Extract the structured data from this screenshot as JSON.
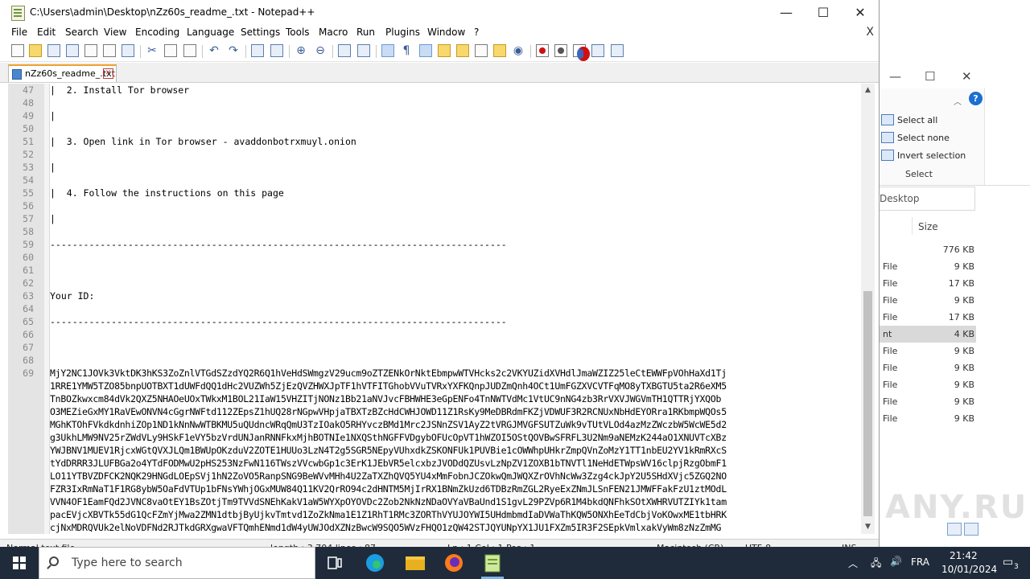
{
  "window": {
    "title": "C:\\Users\\admin\\Desktop\\nZz60s_readme_.txt - Notepad++"
  },
  "menu": [
    "File",
    "Edit",
    "Search",
    "View",
    "Encoding",
    "Language",
    "Settings",
    "Tools",
    "Macro",
    "Run",
    "Plugins",
    "Window",
    "?"
  ],
  "menu_close": "X",
  "tab": {
    "label": "nZz60s_readme_.txt"
  },
  "editor": {
    "lines": [
      {
        "n": "47",
        "text": "|  2. Install Tor browser"
      },
      {
        "n": "48",
        "text": ""
      },
      {
        "n": "49",
        "text": "|"
      },
      {
        "n": "50",
        "text": ""
      },
      {
        "n": "51",
        "text": "|  3. Open link in Tor browser - avaddonbotrxmuyl.onion"
      },
      {
        "n": "52",
        "text": ""
      },
      {
        "n": "53",
        "text": "|"
      },
      {
        "n": "54",
        "text": ""
      },
      {
        "n": "55",
        "text": "|  4. Follow the instructions on this page"
      },
      {
        "n": "56",
        "text": ""
      },
      {
        "n": "57",
        "text": "|"
      },
      {
        "n": "58",
        "text": ""
      },
      {
        "n": "59",
        "text": "----------------------------------------------------------------------------------"
      },
      {
        "n": "60",
        "text": ""
      },
      {
        "n": "61",
        "text": ""
      },
      {
        "n": "62",
        "text": ""
      },
      {
        "n": "63",
        "text": "Your ID:"
      },
      {
        "n": "64",
        "text": ""
      },
      {
        "n": "65",
        "text": "----------------------------------------------------------------------------------"
      },
      {
        "n": "66",
        "text": ""
      },
      {
        "n": "67",
        "text": ""
      },
      {
        "n": "68",
        "text": ""
      },
      {
        "n": "69",
        "text": ""
      }
    ],
    "id_block": [
      "MjY2NC1JOVk3VktDK3hKS3ZoZnlVTGdSZzdYQ2R6Q1hVeHdSWmgzV29ucm9oZTZENkOrNktEbmpwWTVHcks2c2VKYUZidXVHdlJmaWZIZ25leCtEWWFpVOhHaXd1Tj",
      "1RRE1YMW5TZO85bnpUOTBXT1dUWFdQQ1dHc2VUZWh5ZjEzQVZHWXJpTF1hVTFITGhobVVuTVRxYXFKQnpJUDZmQnh4OCt1UmFGZXVCVTFqMO8yTXBGTU5ta2R6eXM5",
      "TnBOZkwxcm84dVk2QXZ5NHAOeUOxTWkxM1BOL21IaW15VHZITjNONz1Bb21aNVJvcFBHWHE3eGpENFo4TnNWTVdMc1VtUC9nNG4zb3RrVXVJWGVmTH1QTTRjYXQOb",
      "O3MEZieGxMY1RaVEwONVN4cGgrNWFtd112ZEpsZ1hUQ28rNGpwVHpjaTBXTzBZcHdCWHJOWD11Z1RsKy9MeDBRdmFKZjVDWUF3R2RCNUxNbHdEYORra1RKbmpWQOs5",
      "MGhKTOhFVkdkdnhiZOp1ND1kNnNwWTBKMU5uQUdncWRqQmU3TzIOakO5RHYvczBMd1Mrc2JSNnZSV1AyZ2tVRGJMVGFSUTZuWk9vTUtVLOd4azMzZWczbW5WcWE5d2",
      "g3UkhLMW9NV25rZWdVLy9HSkF1eVY5bzVrdUNJanRNNFkxMjhBOTNIe1NXQSthNGFFVDgybOFUcOpVT1hWZOI5OStQOVBwSFRFL3U2Nm9aNEMzK244aO1XNUVTcXBz",
      "YWJBNV1MUEV1RjcxWGtQVXJLQm1BWUpOKzduV2ZOTE1HUUo3LzN4T2g5SGR5NEpyVUhxdkZSKONFUk1PUVBie1cOWWhpUHkrZmpQVnZoMzY1TT1nbEU2YV1kRmRXcS",
      "tYdDRRR3JLUFBGa2o4YTdFODMwU2pHS253NzFwN116TWszVVcwbGp1c3ErK1JEbVR5elcxbzJVODdQZUsvLzNpZV1ZOXB1bTNVTl1NeHdETWpsWV16clpjRzgObmF1",
      "LO11YTBVZDFCK2NQK29HNGdLOEpSVj1hN2ZoVO5RanpSNG9BeWVvMHh4U2ZaTXZhQVQ5YU4xMmFobnJCZOkwQmJWQXZrOVhNcWw3Zzg4ckJpY2U5SHdXVjc5ZGQ2NO",
      "FZR3IxRmNaT1F1RG8ybW5OaFdVTUp1bFNsYWhjOGxMUW84Q11KV2QrRO94c2dHNTM5MjIrRX1BNmZkUzd6TDBzRmZGL2RyeExZNmJLSnFEN21JMWFFakFzU1ztMOdL",
      "VVN4OF1EamFQd2JVNC8vaOtEY1BsZOtjTm9TVVdSNEhKakV1aW5WYXpOYOVDc2Zob2NkNzNDaOVYaVBaUnd1S1gvL29PZVp6R1M4bkdQNFhkSOtXWHRVUTZIYk1tam",
      "pacEVjcXBVTk55dG1QcFZmYjMwa2ZMN1dtbjByUjkvTmtvd1ZoZkNma1E1Z1RhT1RMc3ZORThVYUJOYWI5UHdmbmdIaDVWaThKQW5ONXhEeTdCbjVoKOwxME1tbHRK",
      "cjNxMDRQVUk2elNoVDFNd2RJTkdGRXgwaVFTQmhENmd1dW4yUWJOdXZNzBwcW9SQO5WVzFHQO1zQW42STJQYUNpYX1JU1FXZm5IR3F2SEpkVmlxakVyWm8zNzZmMG"
    ]
  },
  "status": {
    "left": "Normal text file",
    "length": "length : 3,704    lines : 87",
    "pos": "Ln : 1    Col : 1    Pos : 1",
    "eol": "Macintosh (CR)",
    "enc": "UTF-8",
    "ins": "INS"
  },
  "explorer": {
    "ribbon": [
      "Select all",
      "Select none",
      "Invert selection"
    ],
    "group_label": "Select",
    "address": "Desktop",
    "column_size": "Size",
    "files": [
      {
        "type": "",
        "size": "776 KB"
      },
      {
        "type": "File",
        "size": "9 KB"
      },
      {
        "type": "File",
        "size": "17 KB"
      },
      {
        "type": "File",
        "size": "9 KB"
      },
      {
        "type": "File",
        "size": "17 KB"
      },
      {
        "type": "nt",
        "size": "4 KB",
        "selected": true
      },
      {
        "type": "File",
        "size": "9 KB"
      },
      {
        "type": "File",
        "size": "9 KB"
      },
      {
        "type": "File",
        "size": "9 KB"
      },
      {
        "type": "File",
        "size": "9 KB"
      },
      {
        "type": "File",
        "size": "9 KB"
      }
    ]
  },
  "taskbar": {
    "search_placeholder": "Type here to search",
    "lang": "FRA",
    "time": "21:42",
    "date": "10/01/2024",
    "notif_count": "3"
  },
  "watermark": "ANY.RUN"
}
